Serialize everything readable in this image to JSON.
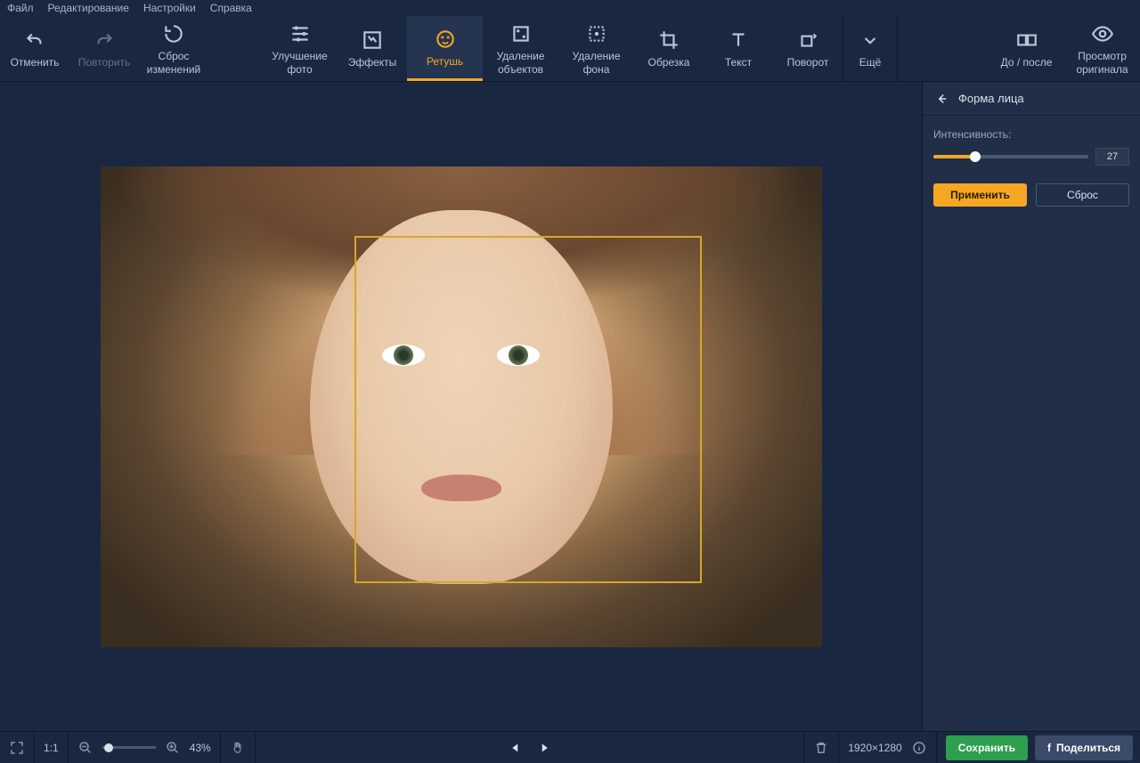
{
  "menu": {
    "file": "Файл",
    "edit": "Редактирование",
    "settings": "Настройки",
    "help": "Справка"
  },
  "toolbar": {
    "undo": "Отменить",
    "redo": "Повторить",
    "reset": "Сброс изменений",
    "enhance": "Улучшение фото",
    "effects": "Эффекты",
    "retouch": "Ретушь",
    "removeObj": "Удаление объектов",
    "removeBg": "Удаление фона",
    "crop": "Обрезка",
    "text": "Текст",
    "rotate": "Поворот",
    "more": "Ещё",
    "beforeAfter": "До / после",
    "viewOriginal": "Просмотр оригинала"
  },
  "panel": {
    "title": "Форма лица",
    "intensityLabel": "Интенсивность:",
    "intensityValue": "27",
    "apply": "Применить",
    "reset": "Сброс"
  },
  "status": {
    "oneToOne": "1:1",
    "zoom": "43%",
    "dimensions": "1920×1280",
    "save": "Сохранить",
    "share": "Поделиться"
  }
}
